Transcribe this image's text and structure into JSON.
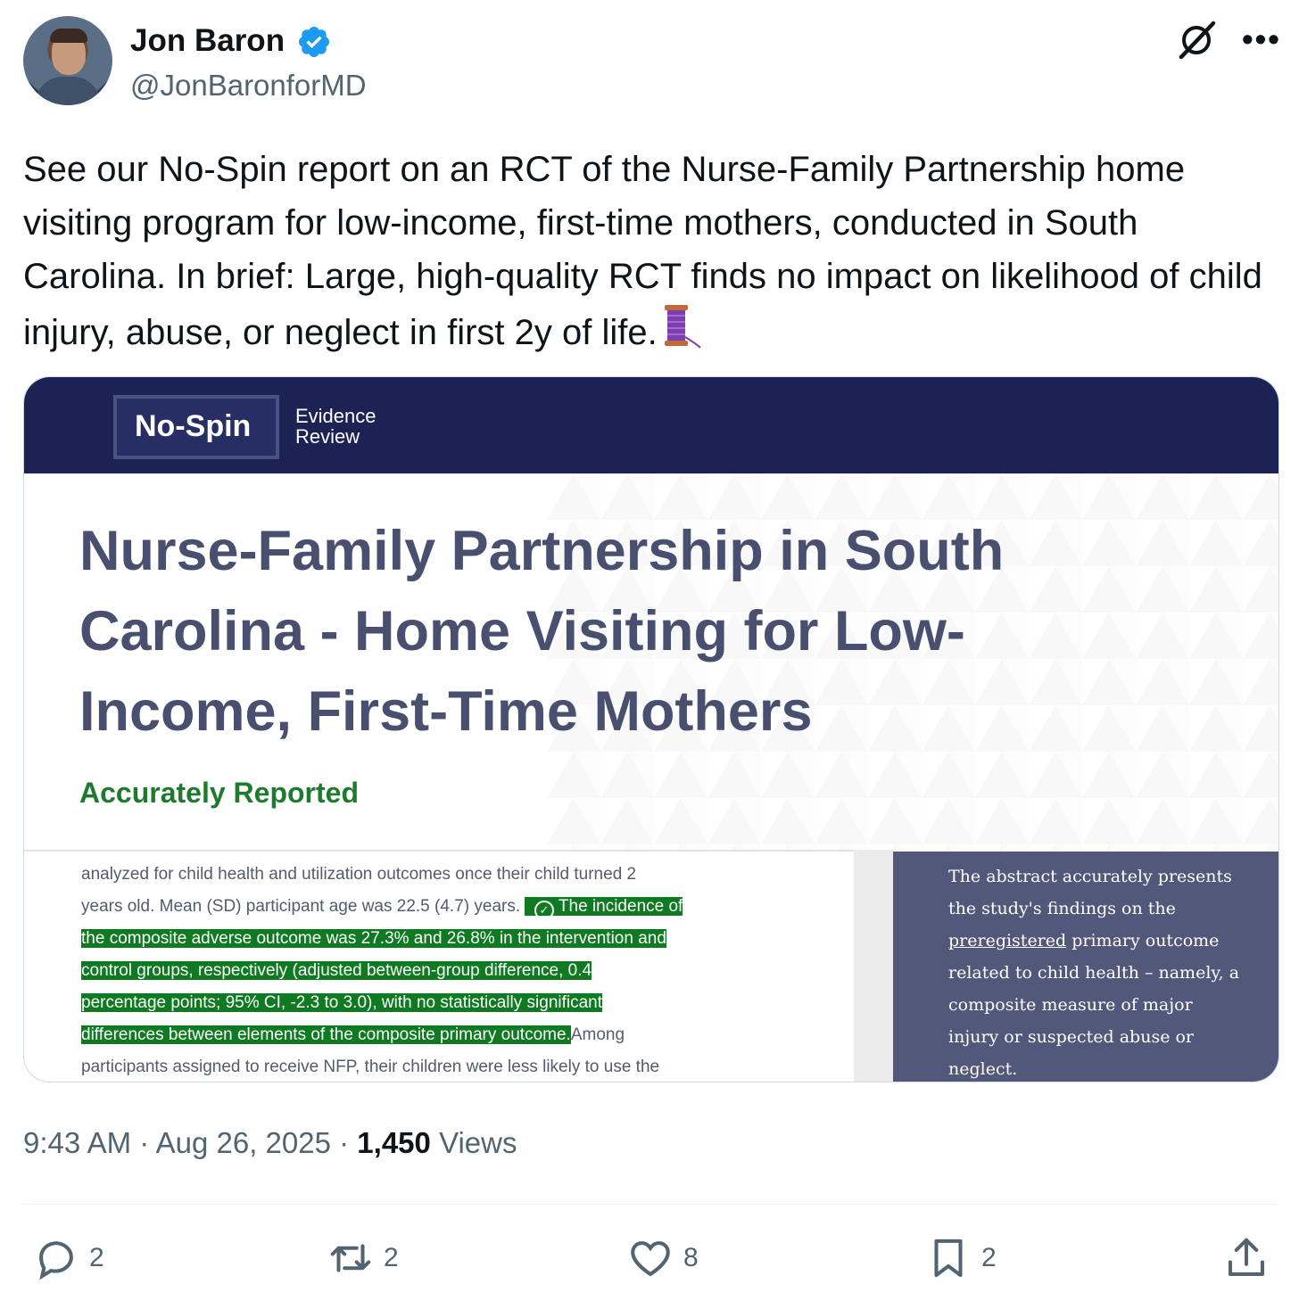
{
  "author": {
    "name": "Jon Baron",
    "handle": "@JonBaronforMD",
    "verified": true,
    "avatar_icon": "avatar"
  },
  "header_icons": [
    "grok-icon",
    "more-icon"
  ],
  "more_glyph": "•••",
  "tweet": {
    "text": "See our No-Spin report on an RCT of the Nurse-Family Partnership home visiting program for low-income, first-time mothers, conducted in South Carolina. In brief: Large, high-quality RCT finds no impact on likelihood of child injury, abuse, or neglect in first 2y of life.",
    "emoji": "spool-of-thread-icon"
  },
  "card": {
    "logo_main": "No-Spin",
    "logo_sub_1": "Evidence",
    "logo_sub_2": "Review",
    "title": "Nurse-Family Partnership in South Carolina - Home Visiting for Low-Income, First-Time Mothers",
    "status": "Accurately Reported",
    "status_color": "#1e7b2e",
    "header_color": "#1c2354",
    "excerpt": {
      "line1": "analyzed for child health and utilization outcomes once their child turned 2",
      "line2_plain": "years old. Mean (SD) participant age was 22.5 (4.7) years.",
      "highlight_1": "The incidence of",
      "highlight_2": "the composite adverse outcome was 27.3% and 26.8% in the intervention and",
      "highlight_3": "control groups, respectively (adjusted between-group difference, 0.4",
      "highlight_4": "percentage points; 95% CI, -2.3 to 3.0), with no statistically significant",
      "highlight_5": "differences between elements of the composite primary outcome.",
      "after_highlight": "Among",
      "line_last": "participants assigned to receive NFP, their children were less likely to use the",
      "highlight_color": "#0f7a22"
    },
    "sidebar": {
      "text_before": "The abstract accurately presents the study's findings on the",
      "underlined": "preregistered",
      "text_after": "primary outcome related to child health – namely, a composite measure of major injury or suspected abuse or neglect."
    }
  },
  "meta": {
    "time": "9:43 AM",
    "sep1": "·",
    "date": "Aug 26, 2025",
    "sep2": "·",
    "views_count": "1,450",
    "views_label": "Views"
  },
  "actions": {
    "replies": "2",
    "reposts": "2",
    "likes": "8",
    "bookmarks": "2"
  }
}
